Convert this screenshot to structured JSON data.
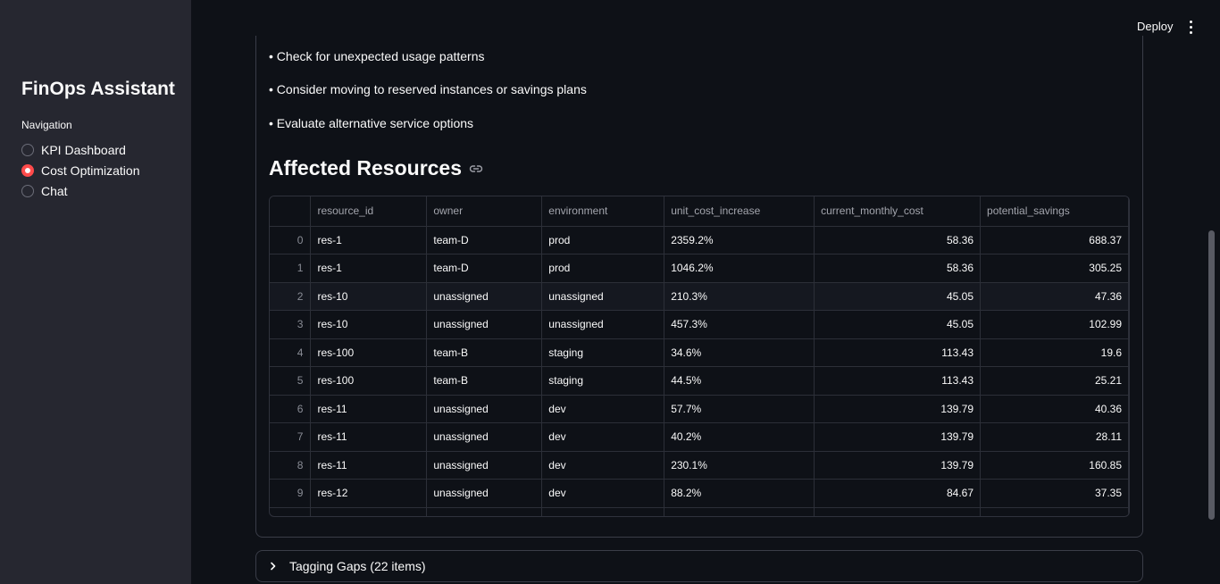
{
  "sidebar": {
    "title": "FinOps Assistant",
    "nav_label": "Navigation",
    "nav_items": [
      {
        "label": "KPI Dashboard",
        "selected": false
      },
      {
        "label": "Cost Optimization",
        "selected": true
      },
      {
        "label": "Chat",
        "selected": false
      }
    ]
  },
  "header": {
    "deploy_label": "Deploy",
    "menu_icon": "vertical-dots-icon"
  },
  "content": {
    "bullets": [
      "• Check for unexpected usage patterns",
      "• Consider moving to reserved instances or savings plans",
      "• Evaluate alternative service options"
    ],
    "heading": "Affected Resources",
    "heading_icon": "link-icon"
  },
  "table": {
    "columns": [
      "",
      "resource_id",
      "owner",
      "environment",
      "unit_cost_increase",
      "current_monthly_cost",
      "potential_savings"
    ],
    "rows": [
      [
        "0",
        "res-1",
        "team-D",
        "prod",
        "2359.2%",
        "58.36",
        "688.37"
      ],
      [
        "1",
        "res-1",
        "team-D",
        "prod",
        "1046.2%",
        "58.36",
        "305.25"
      ],
      [
        "2",
        "res-10",
        "unassigned",
        "unassigned",
        "210.3%",
        "45.05",
        "47.36"
      ],
      [
        "3",
        "res-10",
        "unassigned",
        "unassigned",
        "457.3%",
        "45.05",
        "102.99"
      ],
      [
        "4",
        "res-100",
        "team-B",
        "staging",
        "34.6%",
        "113.43",
        "19.6"
      ],
      [
        "5",
        "res-100",
        "team-B",
        "staging",
        "44.5%",
        "113.43",
        "25.21"
      ],
      [
        "6",
        "res-11",
        "unassigned",
        "dev",
        "57.7%",
        "139.79",
        "40.36"
      ],
      [
        "7",
        "res-11",
        "unassigned",
        "dev",
        "40.2%",
        "139.79",
        "28.11"
      ],
      [
        "8",
        "res-11",
        "unassigned",
        "dev",
        "230.1%",
        "139.79",
        "160.85"
      ],
      [
        "9",
        "res-12",
        "unassigned",
        "dev",
        "88.2%",
        "84.67",
        "37.35"
      ]
    ]
  },
  "expander": {
    "label": "Tagging Gaps (22 items)",
    "icon": "chevron-right-icon"
  },
  "colors": {
    "background": "#0e1117",
    "sidebar": "#262730",
    "accent": "#ff4b4b"
  }
}
